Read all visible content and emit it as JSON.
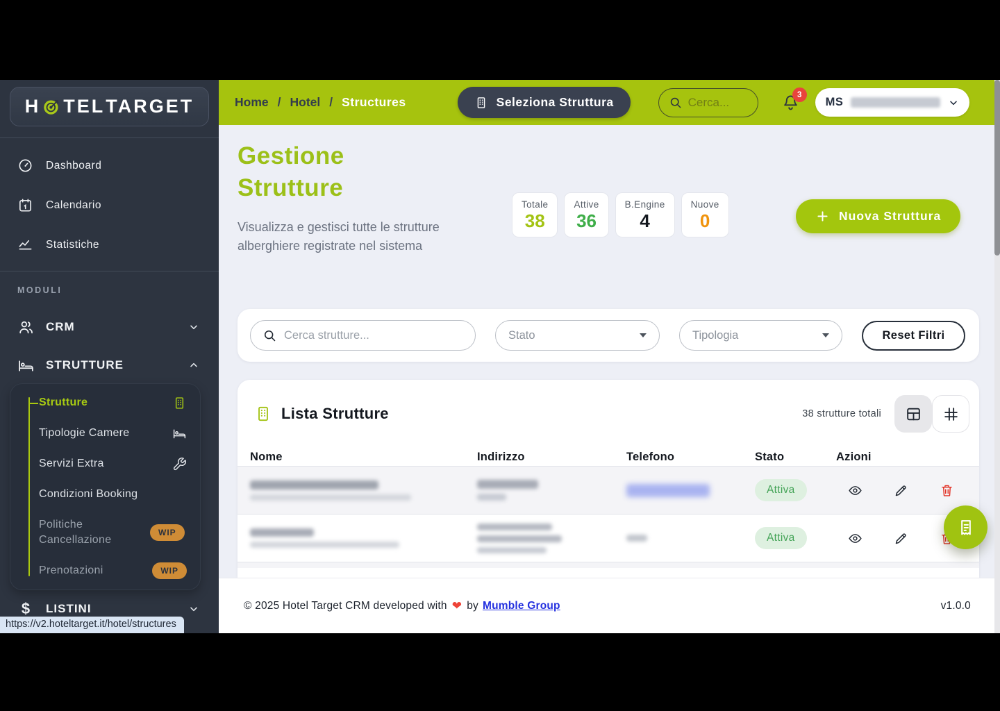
{
  "logo": {
    "part1": "H",
    "part2": "TEL",
    "part3": "TARGET"
  },
  "sidebar": {
    "nav": [
      {
        "label": "Dashboard",
        "icon": "gauge-icon"
      },
      {
        "label": "Calendario",
        "icon": "calendar-icon"
      },
      {
        "label": "Statistiche",
        "icon": "trend-icon"
      }
    ],
    "section_label": "MODULI",
    "modules": [
      {
        "label": "CRM",
        "icon": "users-icon",
        "state": "collapsed"
      },
      {
        "label": "STRUTTURE",
        "icon": "bed-icon",
        "state": "expanded"
      }
    ],
    "submenu": [
      {
        "label": "Strutture",
        "icon": "building-icon",
        "active": true
      },
      {
        "label": "Tipologie Camere",
        "icon": "bed-icon"
      },
      {
        "label": "Servizi Extra",
        "icon": "wrench-icon"
      },
      {
        "label": "Condizioni Booking"
      },
      {
        "label": "Politiche Cancellazione",
        "badge": "WIP"
      },
      {
        "label": "Prenotazioni",
        "badge": "WIP"
      }
    ],
    "listini_label": "LISTINI",
    "status_url": "https://v2.hoteltarget.it/hotel/structures"
  },
  "topbar": {
    "breadcrumb": [
      "Home",
      "Hotel",
      "Structures"
    ],
    "select_structure_button": "Seleziona Struttura",
    "search_placeholder": "Cerca...",
    "notification_count": "3",
    "user_initials": "MS"
  },
  "page": {
    "title": "Gestione Strutture",
    "subtitle": "Visualizza e gestisci tutte le strutture alberghiere registrate nel sistema",
    "stats": [
      {
        "label": "Totale",
        "value": "38",
        "color": "#a3c313"
      },
      {
        "label": "Attive",
        "value": "36",
        "color": "#3fae49"
      },
      {
        "label": "B.Engine",
        "value": "4",
        "color": "#14181f"
      },
      {
        "label": "Nuove",
        "value": "0",
        "color": "#f0930c"
      }
    ],
    "new_structure_button": "Nuova Struttura"
  },
  "filters": {
    "search_placeholder": "Cerca strutture...",
    "stato_label": "Stato",
    "tipologia_label": "Tipologia",
    "reset_label": "Reset Filtri"
  },
  "list": {
    "title": "Lista Strutture",
    "total_label": "38 strutture totali",
    "view_toggles": [
      "table-view-icon",
      "grid-view-icon"
    ],
    "columns": [
      "Nome",
      "Indirizzo",
      "Telefono",
      "Stato",
      "Azioni"
    ],
    "rows": [
      {
        "status": "Attiva",
        "name": "[redacted]",
        "address": "[redacted]",
        "phone": "[redacted link]"
      },
      {
        "status": "Attiva",
        "name": "[redacted]",
        "address": "[redacted]",
        "phone": "[redacted]"
      }
    ]
  },
  "footer": {
    "copyright": "© 2025 Hotel Target CRM developed with",
    "heart": "❤",
    "by": "by",
    "link": "Mumble Group",
    "version": "v1.0.0"
  },
  "colors": {
    "accent_green": "#a6c30e",
    "sidebar_navy": "#2d3440",
    "status_active_bg": "#def0e0",
    "status_active_text": "#43a356",
    "wip_orange": "#cf8c36",
    "danger_red": "#e23226",
    "link_blue": "#2330df",
    "notification_red": "#e8443c"
  }
}
